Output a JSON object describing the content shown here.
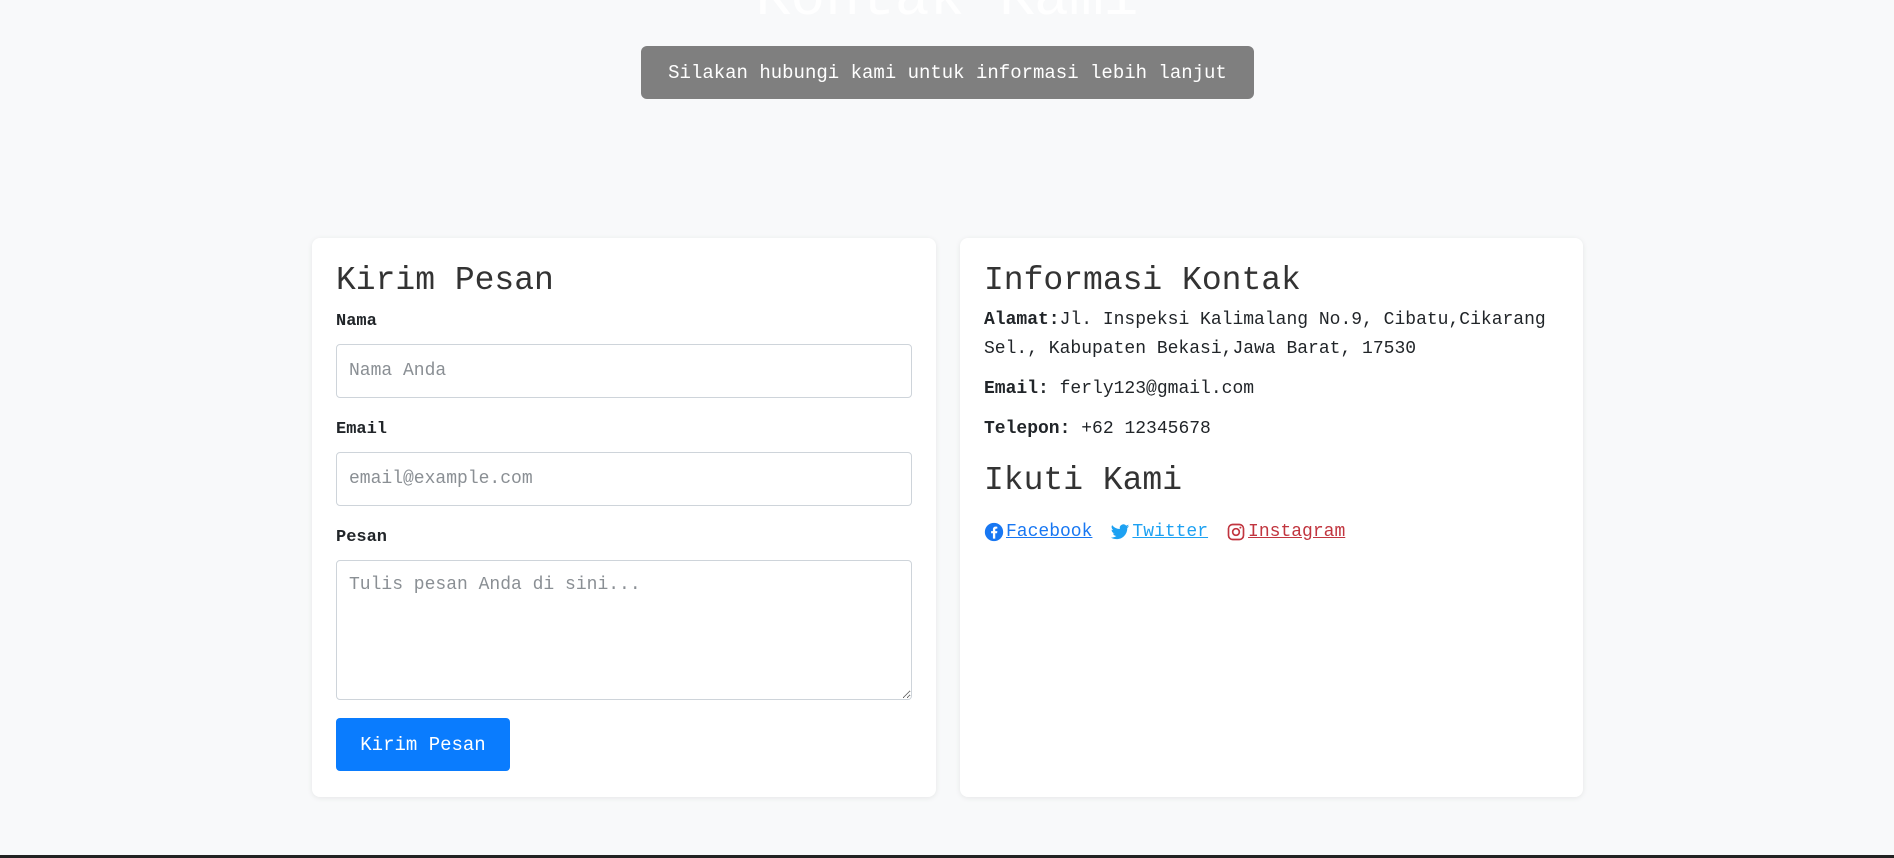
{
  "hero": {
    "title": "Kontak Kami",
    "subtitle": "Silakan hubungi kami untuk informasi lebih lanjut"
  },
  "form": {
    "heading": "Kirim Pesan",
    "name_label": "Nama",
    "name_placeholder": "Nama Anda",
    "email_label": "Email",
    "email_placeholder": "email@example.com",
    "message_label": "Pesan",
    "message_placeholder": "Tulis pesan Anda di sini...",
    "submit_label": "Kirim Pesan"
  },
  "info": {
    "heading": "Informasi Kontak",
    "address_label": "Alamat:",
    "address_value": "Jl. Inspeksi Kalimalang No.9, Cibatu,Cikarang Sel., Kabupaten Bekasi,Jawa Barat, 17530",
    "email_label": "Email:",
    "email_value": "ferly123@gmail.com",
    "phone_label": "Telepon:",
    "phone_value": "+62 12345678",
    "follow_heading": "Ikuti Kami",
    "social": [
      {
        "label": " Facebook",
        "icon": "facebook-icon",
        "color": "#1877f2"
      },
      {
        "label": " Twitter",
        "icon": "twitter-icon",
        "color": "#1da1f2"
      },
      {
        "label": " Instagram",
        "icon": "instagram-icon",
        "color": "#c1353f"
      }
    ]
  },
  "colors": {
    "background": "#f8f9fa",
    "primary_button": "#0a7cfe",
    "badge": "#7f7f7f"
  }
}
